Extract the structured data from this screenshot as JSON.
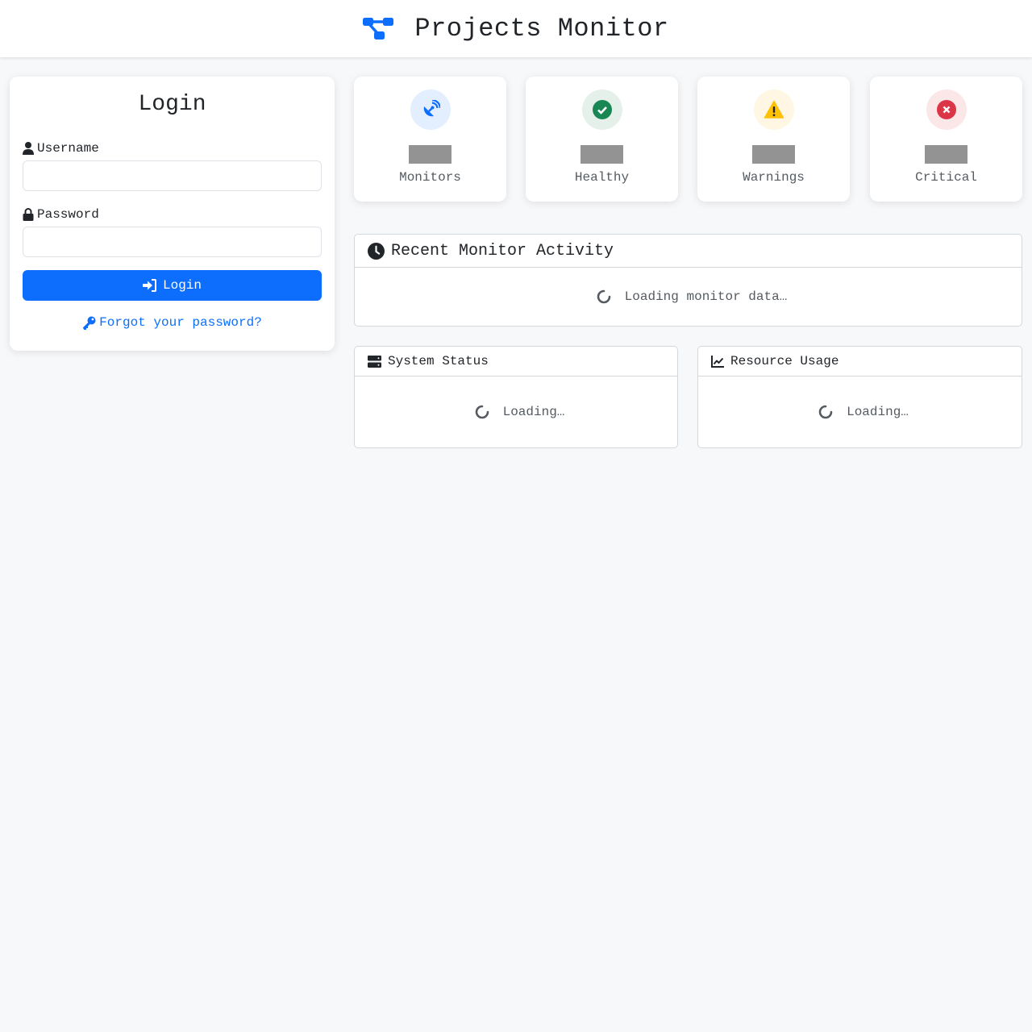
{
  "header": {
    "title": "Projects Monitor",
    "icon": "sitemap-icon",
    "accent": "#0d6efd"
  },
  "login": {
    "title": "Login",
    "username_label": "Username",
    "username_value": "",
    "password_label": "Password",
    "password_value": "",
    "submit_label": "Login",
    "forgot_label": "Forgot your password?"
  },
  "stats": [
    {
      "label": "Monitors",
      "value": "",
      "icon": "satellite-dish-icon",
      "color": "#0d6efd"
    },
    {
      "label": "Healthy",
      "value": "",
      "icon": "check-circle-icon",
      "color": "#198754"
    },
    {
      "label": "Warnings",
      "value": "",
      "icon": "warning-triangle-icon",
      "color": "#ffc107"
    },
    {
      "label": "Critical",
      "value": "",
      "icon": "x-circle-icon",
      "color": "#dc3545"
    }
  ],
  "activity": {
    "title": "Recent Monitor Activity",
    "loading_text": "Loading monitor data…"
  },
  "system_status": {
    "title": "System Status",
    "loading_text": "Loading…"
  },
  "resource_usage": {
    "title": "Resource Usage",
    "loading_text": "Loading…"
  }
}
